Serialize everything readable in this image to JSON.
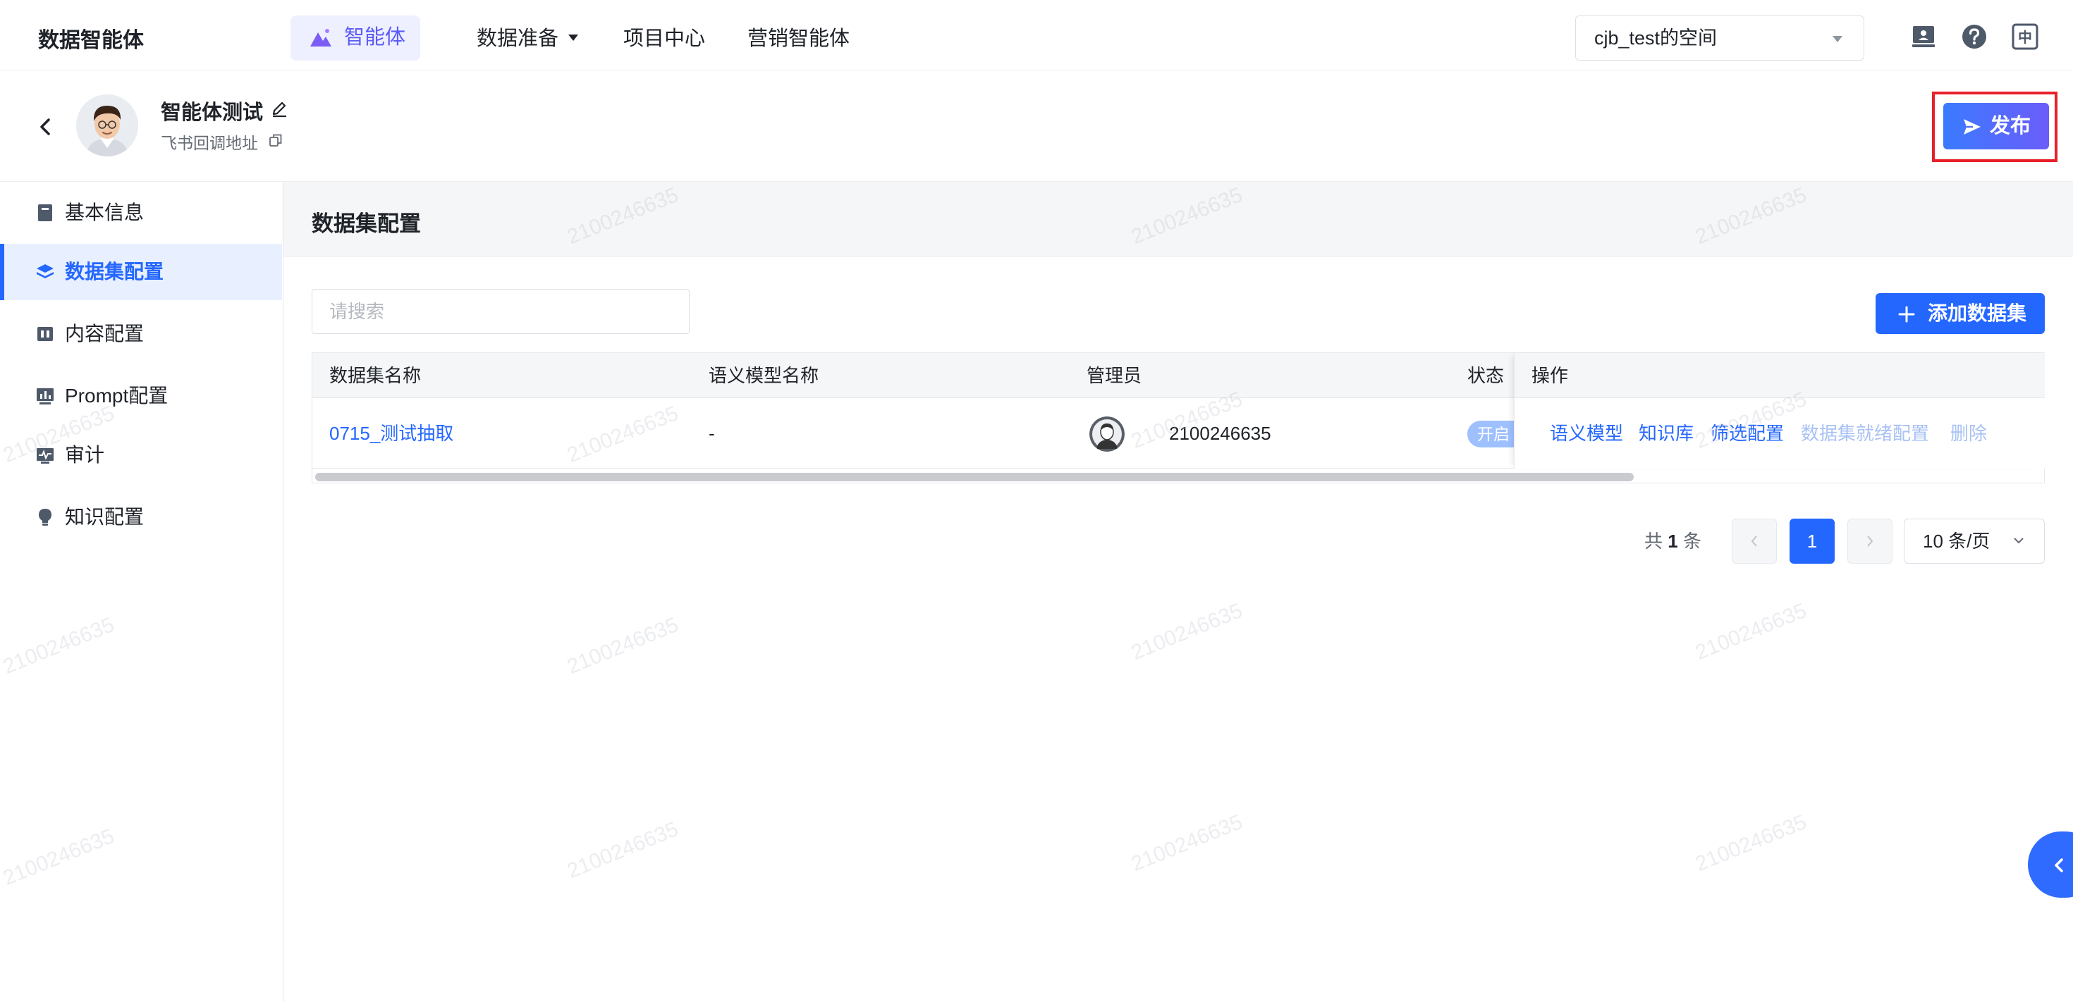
{
  "app": {
    "brand": "数据智能体"
  },
  "topnav": {
    "items": [
      {
        "label": "智能体",
        "active": true
      },
      {
        "label": "数据准备",
        "has_dropdown": true
      },
      {
        "label": "项目中心"
      },
      {
        "label": "营销智能体"
      }
    ],
    "workspace": "cjb_test的空间",
    "icons": [
      "monitor-icon",
      "help-icon",
      "language-icon"
    ],
    "language_glyph": "中"
  },
  "header": {
    "agent_name": "智能体测试",
    "callback_label": "飞书回调地址",
    "publish_label": "发布"
  },
  "sidebar": {
    "items": [
      {
        "label": "基本信息",
        "icon": "document-icon"
      },
      {
        "label": "数据集配置",
        "icon": "layers-icon",
        "active": true
      },
      {
        "label": "内容配置",
        "icon": "content-icon"
      },
      {
        "label": "Prompt配置",
        "icon": "chart-icon"
      },
      {
        "label": "审计",
        "icon": "audit-icon"
      },
      {
        "label": "知识配置",
        "icon": "bulb-icon"
      }
    ]
  },
  "main": {
    "section_title": "数据集配置",
    "search_placeholder": "请搜索",
    "add_button": "添加数据集",
    "table": {
      "columns": [
        "数据集名称",
        "语义模型名称",
        "管理员",
        "状态",
        "操作"
      ],
      "rows": [
        {
          "name": "0715_测试抽取",
          "semantic_model": "-",
          "admin": "2100246635",
          "status": "开启",
          "actions": [
            "语义模型",
            "知识库",
            "筛选配置",
            "数据集就绪配置",
            "删除"
          ]
        }
      ]
    },
    "pagination": {
      "total_prefix": "共",
      "total": "1",
      "total_suffix": "条",
      "current_page": "1",
      "page_size": "10 条/页"
    }
  },
  "watermark": "2100246635",
  "colors": {
    "primary": "#2467ff",
    "publish_gradient_start": "#3a7bff",
    "publish_gradient_end": "#6b5dfa",
    "highlight_frame": "#e8202a"
  }
}
